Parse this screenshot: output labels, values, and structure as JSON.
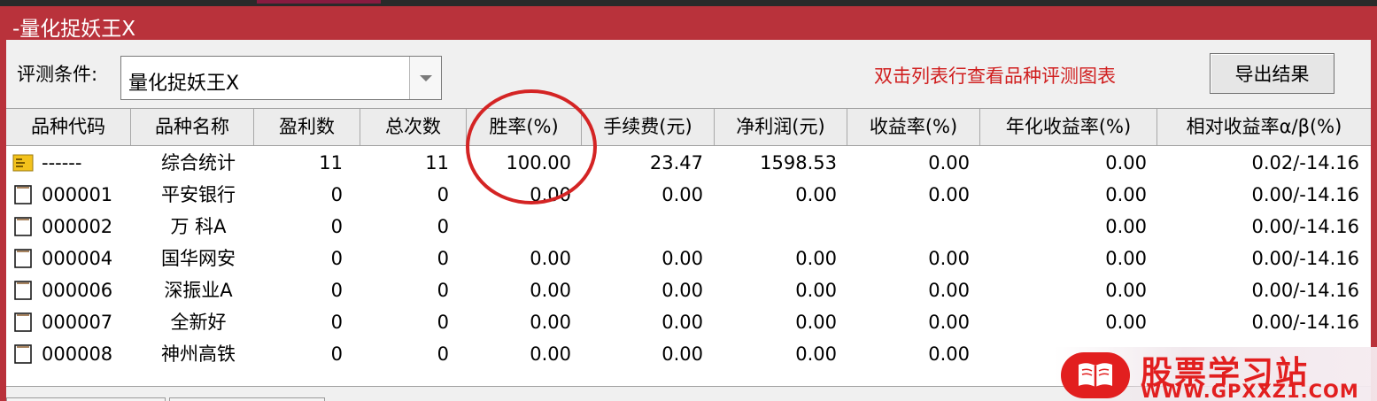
{
  "window": {
    "title": "-量化捉妖王X"
  },
  "toolbar": {
    "condition_label": "评测条件:",
    "condition_value": "量化捉妖王X",
    "hint_text": "双击列表行查看品种评测图表",
    "hint_color": "#d01e1e",
    "export_label": "导出结果"
  },
  "table": {
    "columns": [
      "品种代码",
      "品种名称",
      "盈利数",
      "总次数",
      "胜率(%)",
      "手续费(元)",
      "净利润(元)",
      "收益率(%)",
      "年化收益率(%)",
      "相对收益率α/β(%)"
    ],
    "rows": [
      {
        "icon": "summary-icon",
        "code": "------",
        "name": "综合统计",
        "wins": "11",
        "total": "11",
        "win_rate": "100.00",
        "fee": "23.47",
        "net_profit": "1598.53",
        "yield": "0.00",
        "annual_yield": "0.00",
        "relative": "0.02/-14.16"
      },
      {
        "icon": "document-icon",
        "code": "000001",
        "name": "平安银行",
        "wins": "0",
        "total": "0",
        "win_rate": "0.00",
        "fee": "0.00",
        "net_profit": "0.00",
        "yield": "0.00",
        "annual_yield": "0.00",
        "relative": "0.00/-14.16"
      },
      {
        "icon": "document-icon",
        "code": "000002",
        "name": "万 科A",
        "wins": "0",
        "total": "0",
        "win_rate": "",
        "fee": "",
        "net_profit": "",
        "yield": "",
        "annual_yield": "0.00",
        "relative": "0.00/-14.16"
      },
      {
        "icon": "document-icon",
        "code": "000004",
        "name": "国华网安",
        "wins": "0",
        "total": "0",
        "win_rate": "0.00",
        "fee": "0.00",
        "net_profit": "0.00",
        "yield": "0.00",
        "annual_yield": "0.00",
        "relative": "0.00/-14.16"
      },
      {
        "icon": "document-icon",
        "code": "000006",
        "name": "深振业A",
        "wins": "0",
        "total": "0",
        "win_rate": "0.00",
        "fee": "0.00",
        "net_profit": "0.00",
        "yield": "0.00",
        "annual_yield": "0.00",
        "relative": "0.00/-14.16"
      },
      {
        "icon": "document-icon",
        "code": "000007",
        "name": "全新好",
        "wins": "0",
        "total": "0",
        "win_rate": "0.00",
        "fee": "0.00",
        "net_profit": "0.00",
        "yield": "0.00",
        "annual_yield": "0.00",
        "relative": "0.00/-14.16"
      },
      {
        "icon": "document-icon",
        "code": "000008",
        "name": "神州高铁",
        "wins": "0",
        "total": "0",
        "win_rate": "0.00",
        "fee": "0.00",
        "net_profit": "0.00",
        "yield": "0.00",
        "annual_yield": "",
        "relative": ""
      }
    ]
  },
  "watermark": {
    "brand": "股票学习站",
    "url": "WWW.GPXXZ1.COM",
    "color": "#e21f1f"
  },
  "annotation": {
    "color": "#d42424",
    "target": "胜率(%)"
  },
  "colors": {
    "titlebar": "#b9323b"
  }
}
